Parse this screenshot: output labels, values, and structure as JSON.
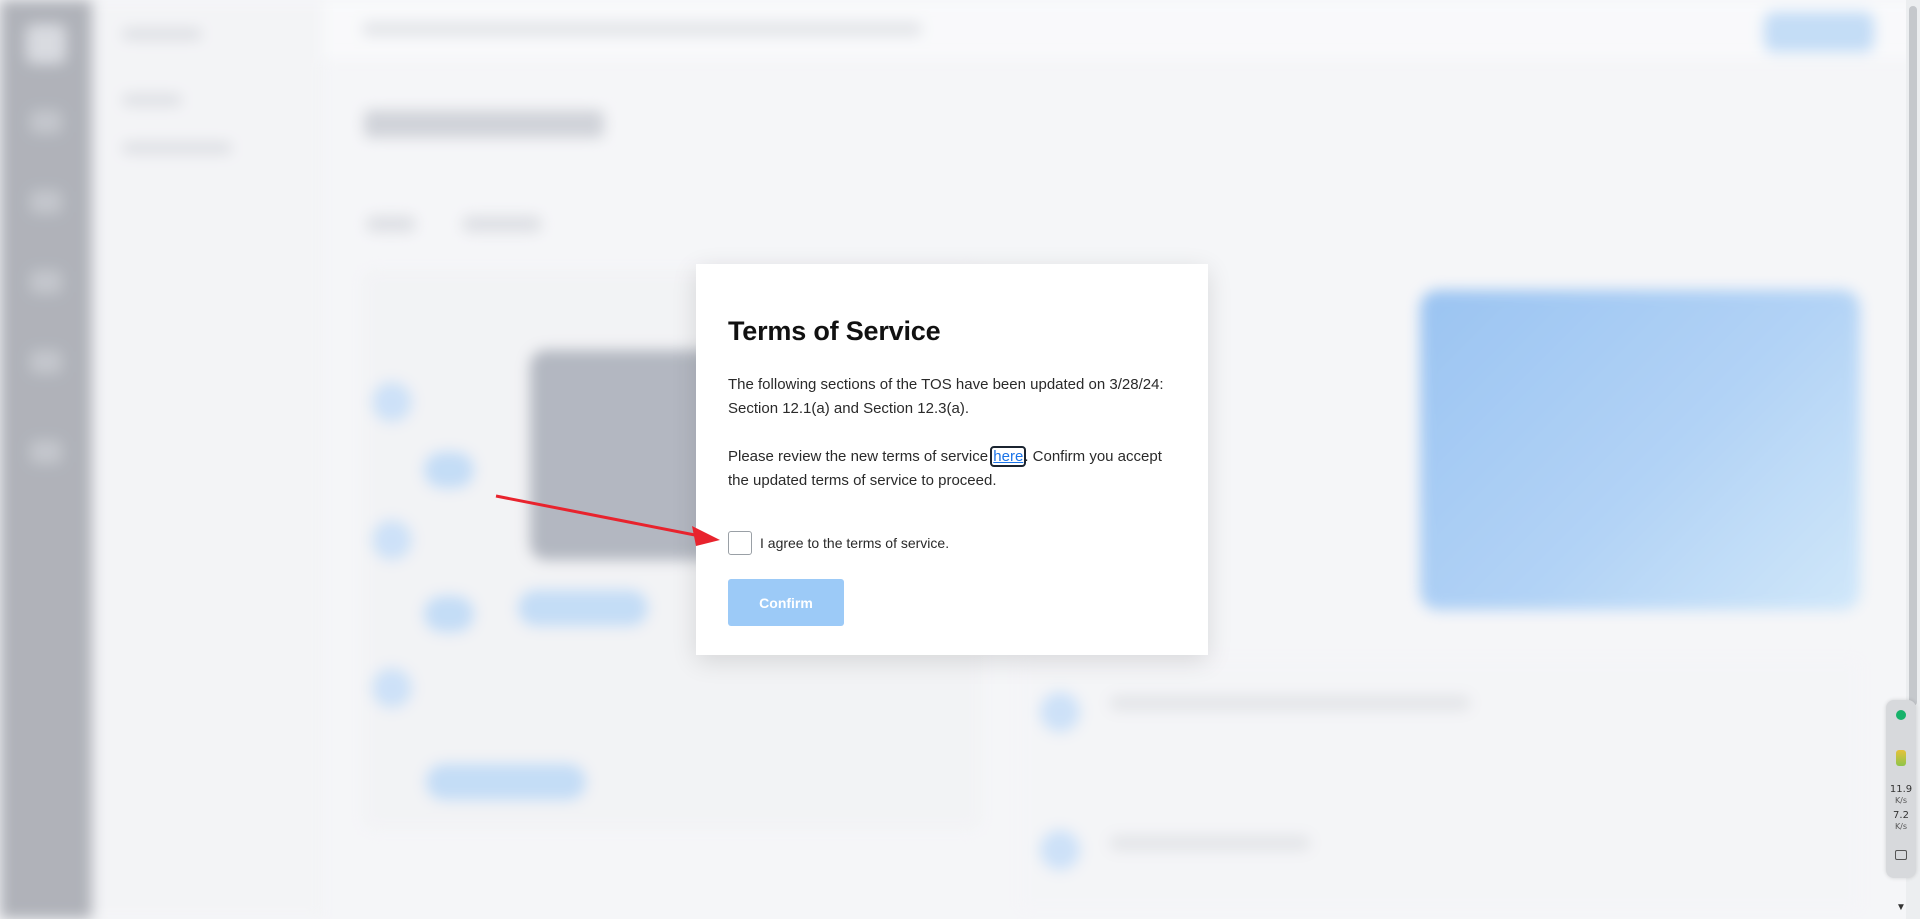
{
  "modal": {
    "title": "Terms of Service",
    "paragraph1": "The following sections of the TOS have been updated on 3/28/24: Section 12.1(a) and Section 12.3(a).",
    "paragraph2_before": "Please review the new terms of service ",
    "paragraph2_link": "here",
    "paragraph2_after": ". Confirm you accept the updated terms of service to proceed.",
    "agree_label": "I agree to the terms of service.",
    "agree_checked": false,
    "confirm_label": "Confirm",
    "confirm_enabled": false
  },
  "colors": {
    "link": "#1a73e8",
    "confirm_disabled_bg": "#9ccaf7",
    "annotation_arrow": "#e8232d"
  },
  "system_widget": {
    "upload_value": "11.9",
    "upload_unit": "K/s",
    "download_value": "7.2",
    "download_unit": "K/s",
    "icons": [
      "status-dot-icon",
      "battery-icon",
      "camera-icon"
    ]
  }
}
